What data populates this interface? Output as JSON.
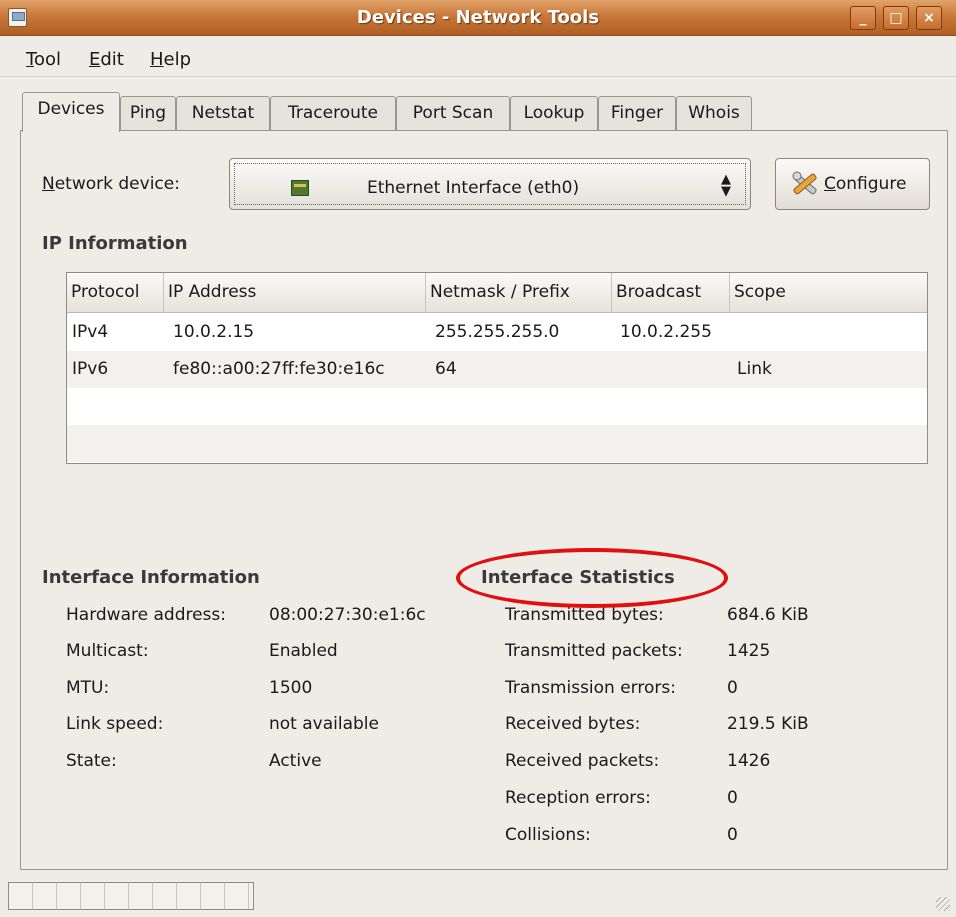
{
  "window": {
    "title": "Devices - Network Tools",
    "min_glyph": "_",
    "max_glyph": "□",
    "close_glyph": "×"
  },
  "menu": [
    {
      "accel": "T",
      "rest": "ool"
    },
    {
      "accel": "E",
      "rest": "dit"
    },
    {
      "accel": "H",
      "rest": "elp"
    }
  ],
  "tabs": [
    "Devices",
    "Ping",
    "Netstat",
    "Traceroute",
    "Port Scan",
    "Lookup",
    "Finger",
    "Whois"
  ],
  "device": {
    "label_accel": "N",
    "label_rest": "etwork device:",
    "selected": "Ethernet Interface (eth0)",
    "configure_accel": "C",
    "configure_rest": "onfigure"
  },
  "ip_info": {
    "title": "IP Information",
    "columns": [
      "Protocol",
      "IP Address",
      "Netmask / Prefix",
      "Broadcast",
      "Scope"
    ],
    "rows": [
      [
        "IPv4",
        "10.0.2.15",
        "255.255.255.0",
        "10.0.2.255",
        ""
      ],
      [
        "IPv6",
        "fe80::a00:27ff:fe30:e16c",
        "64",
        "",
        "Link"
      ]
    ]
  },
  "interface_info": {
    "title": "Interface Information",
    "items": [
      {
        "label": "Hardware address:",
        "value": "08:00:27:30:e1:6c"
      },
      {
        "label": "Multicast:",
        "value": "Enabled"
      },
      {
        "label": "MTU:",
        "value": "1500"
      },
      {
        "label": "Link speed:",
        "value": "not available"
      },
      {
        "label": "State:",
        "value": "Active"
      }
    ]
  },
  "interface_stats": {
    "title": "Interface Statistics",
    "items": [
      {
        "label": "Transmitted bytes:",
        "value": "684.6 KiB"
      },
      {
        "label": "Transmitted packets:",
        "value": "1425"
      },
      {
        "label": "Transmission errors:",
        "value": "0"
      },
      {
        "label": "Received bytes:",
        "value": "219.5 KiB"
      },
      {
        "label": "Received packets:",
        "value": "1426"
      },
      {
        "label": "Reception errors:",
        "value": "0"
      },
      {
        "label": "Collisions:",
        "value": "0"
      }
    ]
  },
  "annotation": {
    "color": "#e01010"
  }
}
